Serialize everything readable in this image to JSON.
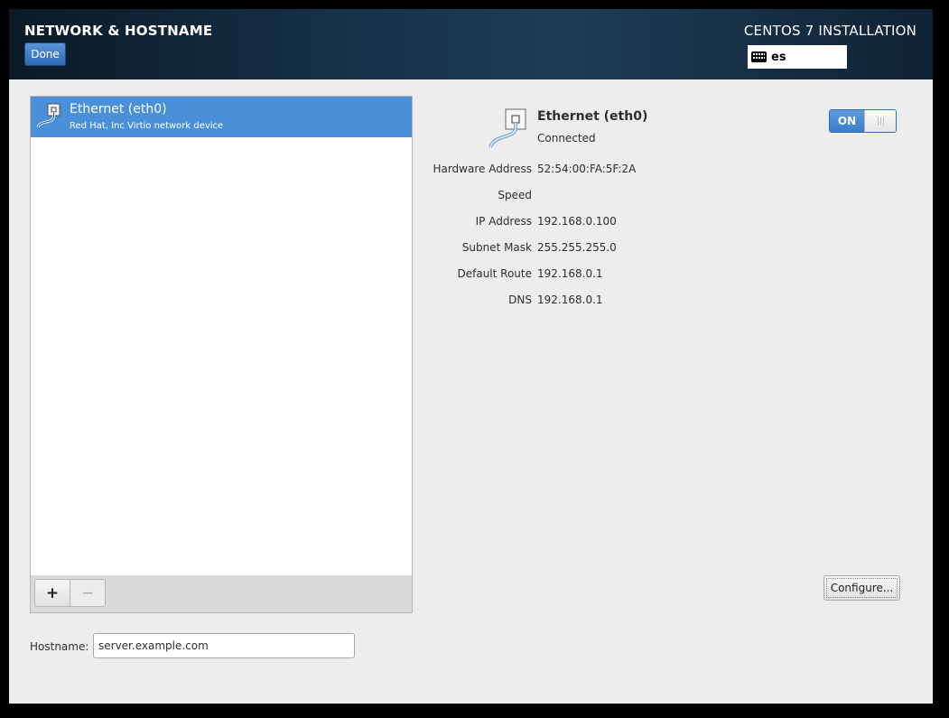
{
  "header": {
    "title": "NETWORK & HOSTNAME",
    "done_label": "Done",
    "product": "CENTOS 7 INSTALLATION",
    "keyboard_layout": "es"
  },
  "devices": [
    {
      "name": "Ethernet (eth0)",
      "description": "Red Hat, Inc Virtio network device"
    }
  ],
  "list_toolbar": {
    "add_label": "+",
    "remove_label": "−"
  },
  "details": {
    "name": "Ethernet (eth0)",
    "status": "Connected",
    "toggle_label": "ON",
    "toggle_state": "on",
    "properties": [
      {
        "label": "Hardware Address",
        "value": "52:54:00:FA:5F:2A"
      },
      {
        "label": "Speed",
        "value": ""
      },
      {
        "label": "IP Address",
        "value": "192.168.0.100"
      },
      {
        "label": "Subnet Mask",
        "value": "255.255.255.0"
      },
      {
        "label": "Default Route",
        "value": "192.168.0.1"
      },
      {
        "label": "DNS",
        "value": "192.168.0.1"
      }
    ],
    "configure_label": "Configure..."
  },
  "hostname": {
    "label": "Hostname:",
    "value": "server.example.com"
  },
  "colors": {
    "accent": "#4a90d9",
    "header_dark": "#0b1a26"
  }
}
